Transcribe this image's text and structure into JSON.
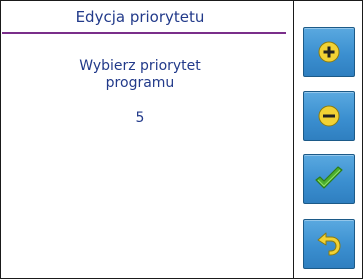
{
  "dialog": {
    "title": "Edycja priorytetu",
    "prompt_line1": "Wybierz priorytet",
    "prompt_line2": "programu",
    "priority_value": "5"
  },
  "buttons": [
    {
      "name": "increase-button",
      "icon": "plus-icon"
    },
    {
      "name": "decrease-button",
      "icon": "minus-icon"
    },
    {
      "name": "confirm-button",
      "icon": "checkmark-icon"
    },
    {
      "name": "back-button",
      "icon": "back-arrow-icon"
    }
  ],
  "colors": {
    "text": "#223a8a",
    "title_rule": "#7a2e8a",
    "button_blue": "#3b8fd0",
    "icon_yellow": "#f2d234",
    "check_green": "#4caf2e"
  }
}
